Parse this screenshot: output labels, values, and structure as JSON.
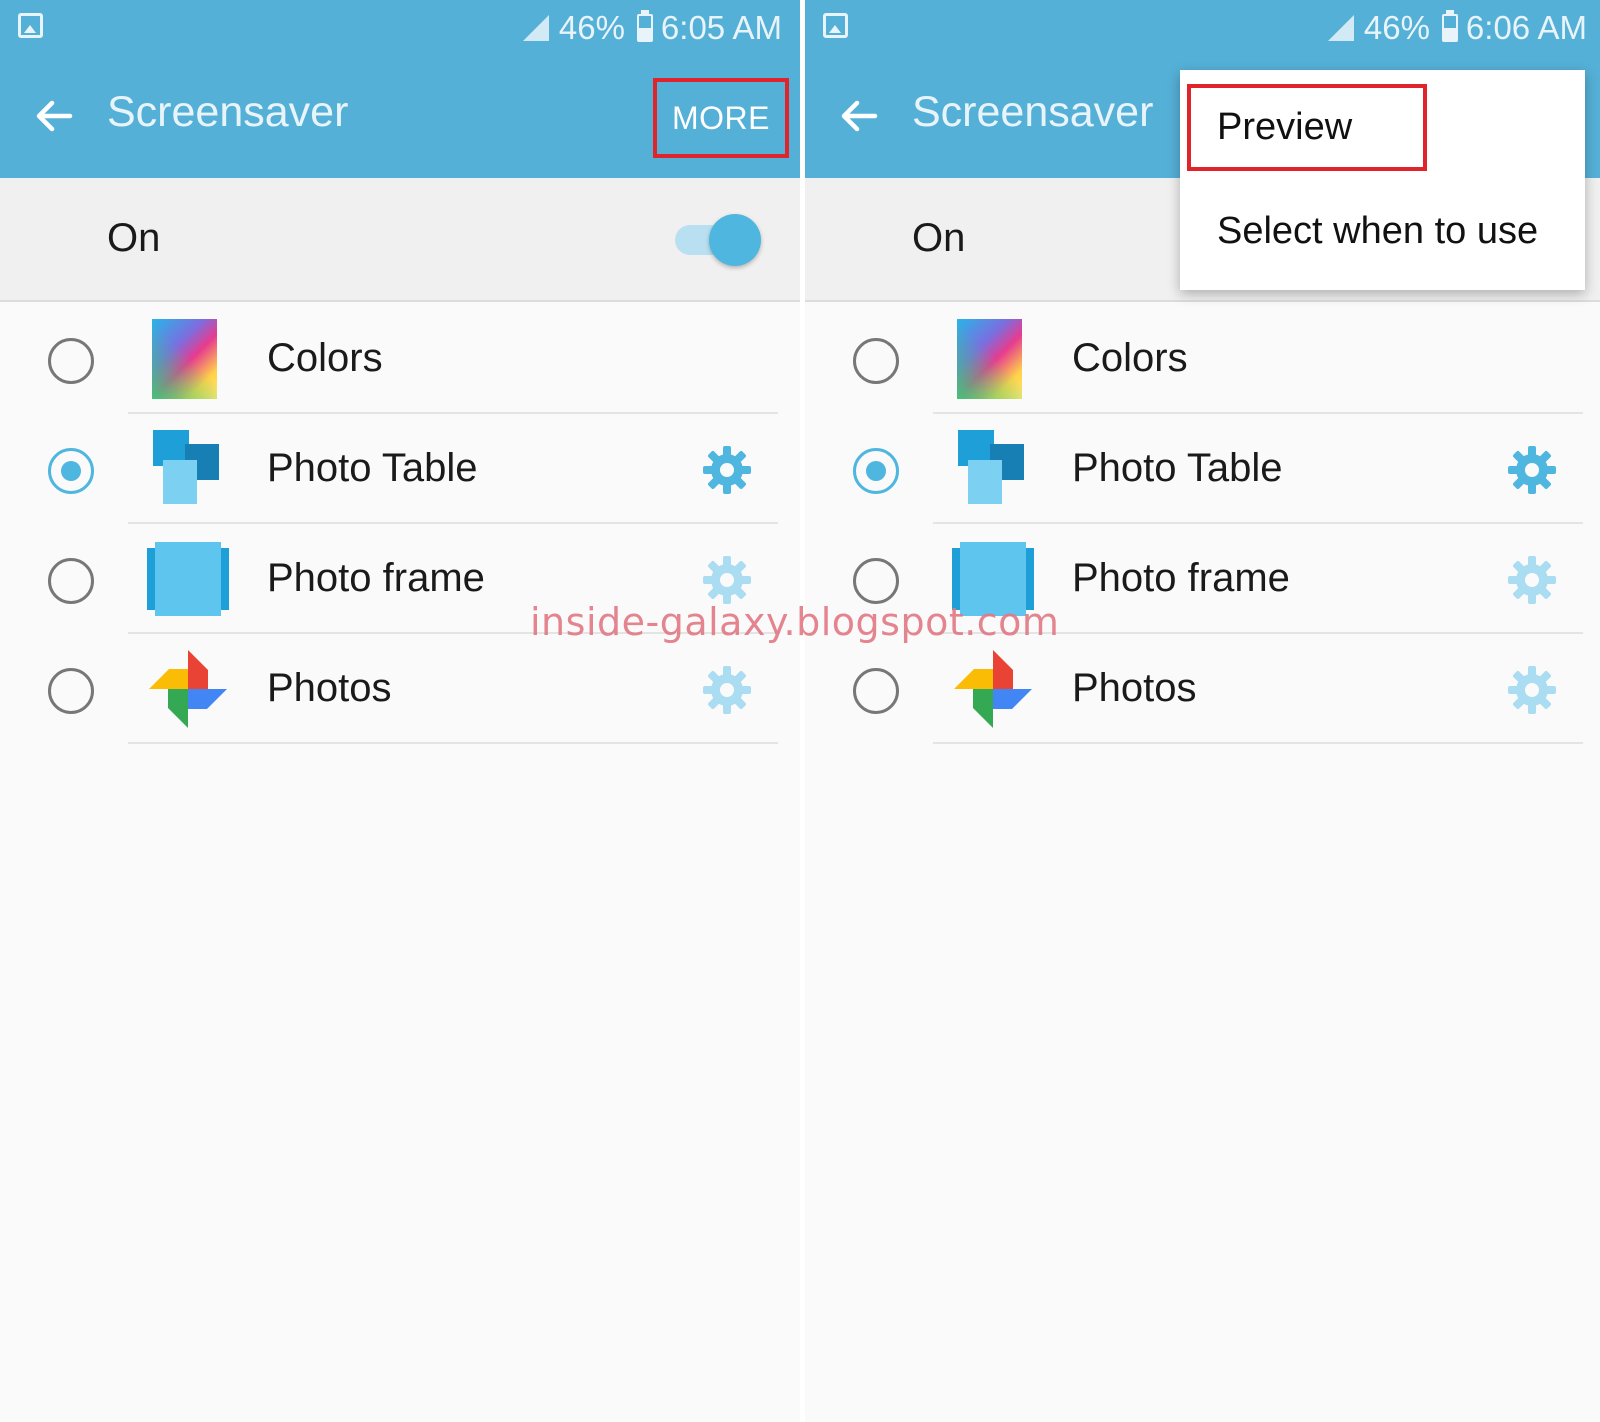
{
  "screens": [
    {
      "status": {
        "battery": "46%",
        "time": "6:05 AM"
      },
      "appbar": {
        "title": "Screensaver",
        "more_label": "MORE"
      },
      "toggle": {
        "label": "On",
        "checked": true
      },
      "items": [
        {
          "label": "Colors",
          "selected": false,
          "has_settings": false
        },
        {
          "label": "Photo Table",
          "selected": true,
          "has_settings": true,
          "settings_enabled": true
        },
        {
          "label": "Photo frame",
          "selected": false,
          "has_settings": true,
          "settings_enabled": false
        },
        {
          "label": "Photos",
          "selected": false,
          "has_settings": true,
          "settings_enabled": false
        }
      ]
    },
    {
      "status": {
        "battery": "46%",
        "time": "6:06 AM"
      },
      "appbar": {
        "title": "Screensaver"
      },
      "toggle": {
        "label": "On"
      },
      "menu": {
        "items": [
          "Preview",
          "Select when to use"
        ]
      },
      "items": [
        {
          "label": "Colors",
          "selected": false,
          "has_settings": false
        },
        {
          "label": "Photo Table",
          "selected": true,
          "has_settings": true,
          "settings_enabled": true
        },
        {
          "label": "Photo frame",
          "selected": false,
          "has_settings": true,
          "settings_enabled": false
        },
        {
          "label": "Photos",
          "selected": false,
          "has_settings": true,
          "settings_enabled": false
        }
      ]
    }
  ],
  "watermark": "inside-galaxy.blogspot.com",
  "colors": {
    "appbar": "#55b0d7",
    "accent": "#4fb6e0",
    "highlight_box": "#e0242c",
    "gear_disabled": "#aadcf2",
    "watermark": "#e27884"
  },
  "icons": [
    "gallery-icon",
    "signal-icon",
    "battery-icon",
    "back-arrow-icon",
    "colors-icon",
    "photo-table-icon",
    "photo-frame-icon",
    "photos-pinwheel-icon",
    "gear-icon"
  ]
}
